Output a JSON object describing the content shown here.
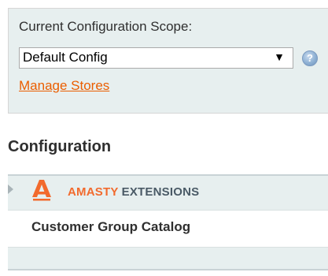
{
  "scope": {
    "label": "Current Configuration Scope:",
    "selected": "Default Config",
    "arrow": "▼",
    "help_glyph": "?",
    "manage_link": "Manage Stores"
  },
  "configuration": {
    "title": "Configuration",
    "group": {
      "brand_word1": "AMASTY",
      "brand_word2": "EXTENSIONS",
      "logo_icon": "amasty-logo-icon",
      "items": [
        {
          "label": "Customer Group Catalog"
        }
      ]
    }
  },
  "colors": {
    "panel_bg": "#e7efef",
    "link": "#eb5e00",
    "brand_orange": "#f26a2d",
    "brand_gray": "#4a5a66"
  }
}
